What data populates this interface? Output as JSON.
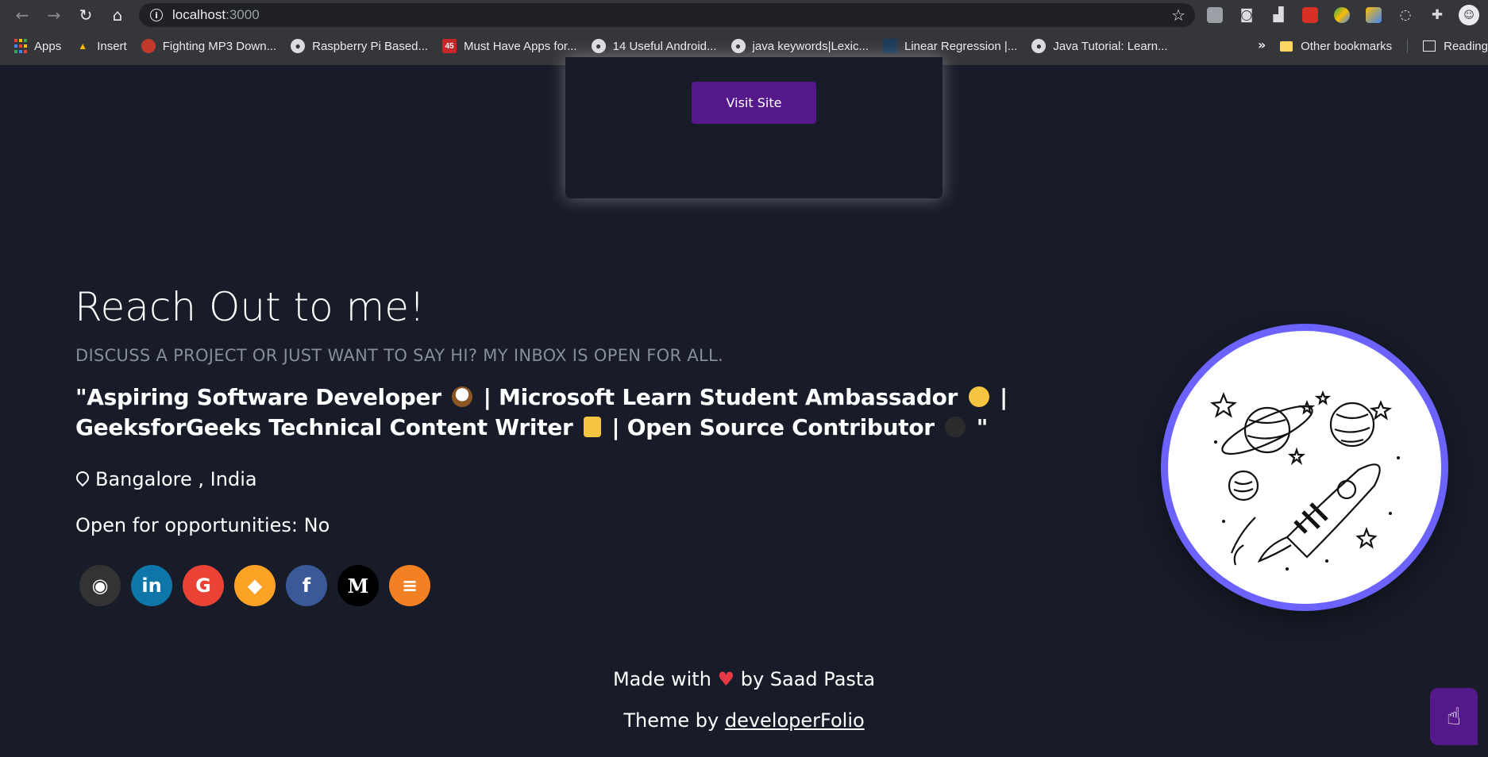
{
  "browser": {
    "url_host": "localhost",
    "url_port": ":3000",
    "bookmarks": [
      {
        "label": "Apps",
        "icon": "apps-grid-icon"
      },
      {
        "label": "Insert",
        "icon": "insert-icon"
      },
      {
        "label": "Fighting MP3 Down...",
        "icon": "site-icon"
      },
      {
        "label": "Raspberry Pi Based...",
        "icon": "globe-icon"
      },
      {
        "label": "Must Have Apps for...",
        "icon": "45-icon"
      },
      {
        "label": "14 Useful Android...",
        "icon": "globe-icon"
      },
      {
        "label": "java keywords|Lexic...",
        "icon": "globe-icon"
      },
      {
        "label": "Linear Regression |...",
        "icon": "site-icon"
      },
      {
        "label": "Java Tutorial: Learn...",
        "icon": "globe-icon"
      }
    ],
    "more_chevron": "»",
    "other_bookmarks": "Other bookmarks",
    "reading_list": "Reading"
  },
  "project_card": {
    "visit_button": "Visit Site"
  },
  "contact": {
    "title": "Reach Out to me!",
    "subtitle": "DISCUSS A PROJECT OR JUST WANT TO SAY HI? MY INBOX IS OPEN FOR ALL.",
    "bio_part1": "\"Aspiring Software Developer",
    "bio_part2": "| Microsoft Learn Student Ambassador",
    "bio_part3": "| GeeksforGeeks Technical Content Writer",
    "bio_part4": "| Open Source Contributor",
    "bio_part5": "\"",
    "location": "Bangalore , India",
    "opportunities": "Open for opportunities: No"
  },
  "socials": [
    {
      "name": "github",
      "glyph": "◉",
      "color": "#333333"
    },
    {
      "name": "linkedin",
      "glyph": "in",
      "color": "#0e76a8"
    },
    {
      "name": "google",
      "glyph": "G",
      "color": "#ea4335"
    },
    {
      "name": "gitlab",
      "glyph": "◆",
      "color": "#fca326"
    },
    {
      "name": "facebook",
      "glyph": "f",
      "color": "#3b5998"
    },
    {
      "name": "medium",
      "glyph": "M",
      "color": "#000000"
    },
    {
      "name": "stackoverflow",
      "glyph": "≡",
      "color": "#f48024"
    }
  ],
  "footer": {
    "made_prefix": "Made with",
    "heart": "♥",
    "made_suffix": "by Saad Pasta",
    "theme_prefix": "Theme by",
    "theme_link": "developerFolio"
  },
  "colors": {
    "page_bg": "#171c28",
    "button_purple": "#55198b",
    "avatar_ring": "#6c63ff",
    "subtitle_gray": "#868e96"
  }
}
